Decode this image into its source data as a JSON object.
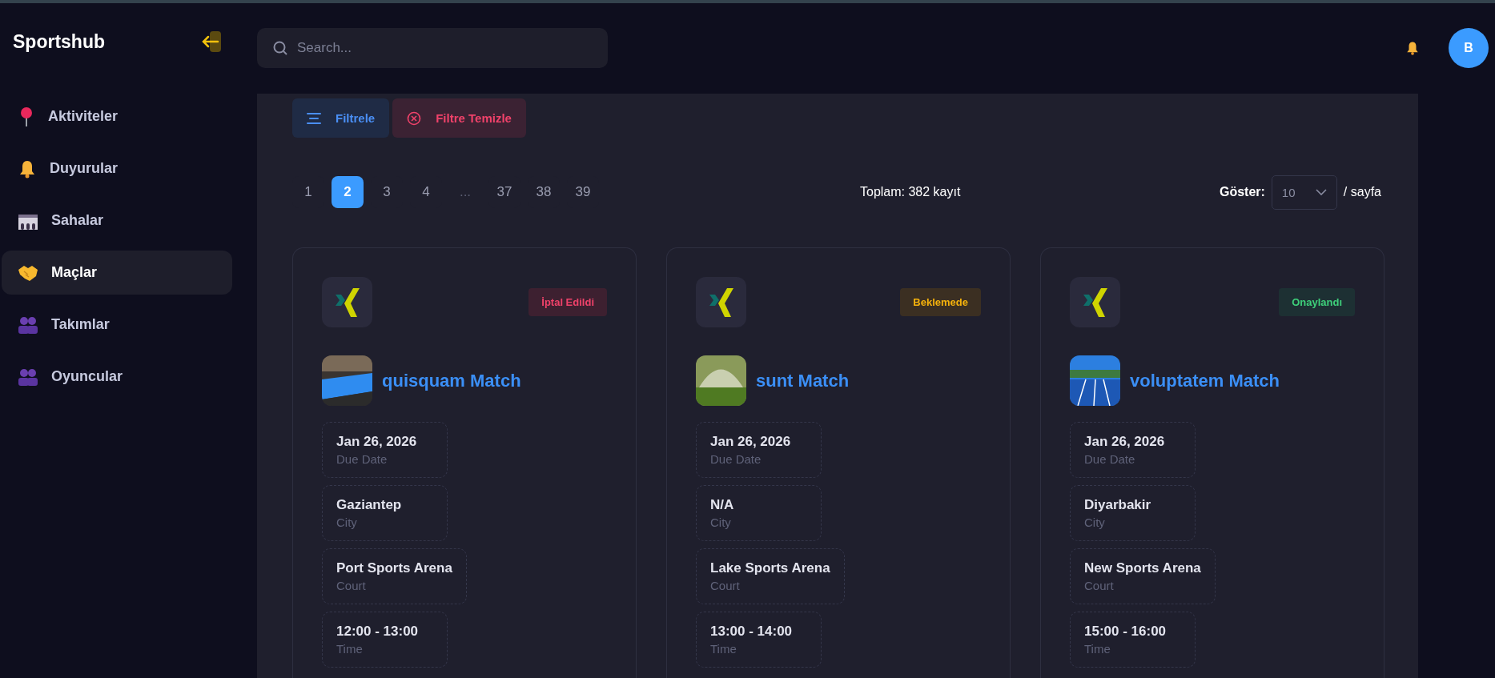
{
  "sidebar": {
    "title": "Sportshub",
    "items": [
      {
        "label": "Aktiviteler",
        "selected": false
      },
      {
        "label": "Duyurular",
        "selected": false
      },
      {
        "label": "Sahalar",
        "selected": false
      },
      {
        "label": "Maçlar",
        "selected": true
      },
      {
        "label": "Takımlar",
        "selected": false
      },
      {
        "label": "Oyuncular",
        "selected": false
      }
    ]
  },
  "topbar": {
    "search": {
      "placeholder": "Search..."
    },
    "avatar": "B"
  },
  "filters": [
    {
      "label": "Filtrele",
      "kind": "filter"
    },
    {
      "label": "Filtre Temizle",
      "kind": "clear"
    }
  ],
  "pagination": {
    "pages": [
      {
        "label": "1",
        "kind": "page",
        "selected": false
      },
      {
        "label": "2",
        "kind": "page",
        "selected": true
      },
      {
        "label": "3",
        "kind": "page",
        "selected": false
      },
      {
        "label": "4",
        "kind": "page",
        "selected": false
      },
      {
        "label": "...",
        "kind": "ellipsis"
      },
      {
        "label": "37",
        "kind": "page",
        "selected": false
      },
      {
        "label": "38",
        "kind": "page",
        "selected": false
      },
      {
        "label": "39",
        "kind": "page",
        "selected": false
      }
    ],
    "total": "Toplam: 382 kayıt",
    "show_label": "Göster:",
    "page_size": "10",
    "suffix": "/ sayfa"
  },
  "cards": [
    {
      "status": {
        "label": "İptal Edildi",
        "kind": "cancelled"
      },
      "title": "quisquam Match",
      "fields": [
        {
          "value": "Jan 26, 2026",
          "label": "Due Date"
        },
        {
          "value": "Gaziantep",
          "label": "City"
        },
        {
          "value": "Port Sports Arena",
          "label": "Court"
        },
        {
          "value": "12:00 - 13:00",
          "label": "Time"
        }
      ]
    },
    {
      "status": {
        "label": "Beklemede",
        "kind": "pending"
      },
      "title": "sunt Match",
      "fields": [
        {
          "value": "Jan 26, 2026",
          "label": "Due Date"
        },
        {
          "value": "N/A",
          "label": "City"
        },
        {
          "value": "Lake Sports Arena",
          "label": "Court"
        },
        {
          "value": "13:00 - 14:00",
          "label": "Time"
        }
      ]
    },
    {
      "status": {
        "label": "Onaylandı",
        "kind": "approved"
      },
      "title": "voluptatem Match",
      "fields": [
        {
          "value": "Jan 26, 2026",
          "label": "Due Date"
        },
        {
          "value": "Diyarbakir",
          "label": "City"
        },
        {
          "value": "New Sports Arena",
          "label": "Court"
        },
        {
          "value": "15:00 - 16:00",
          "label": "Time"
        }
      ]
    }
  ]
}
